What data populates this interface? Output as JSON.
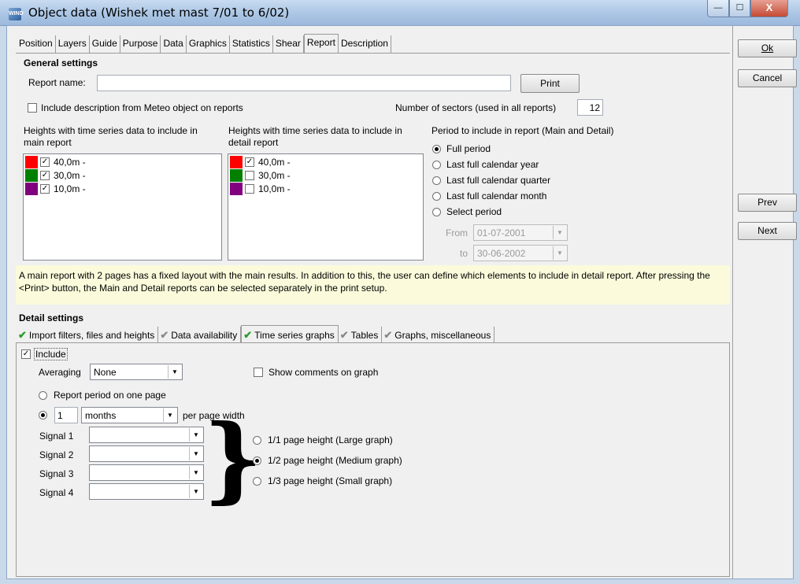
{
  "window": {
    "title": "Object data  (Wishek met mast 7/01 to 6/02)",
    "app_icon_text": "WIND",
    "min": "—",
    "max": "☐",
    "close": "X"
  },
  "side": {
    "ok": "Ok",
    "cancel": "Cancel",
    "prev": "Prev",
    "next": "Next"
  },
  "tabs": [
    "Position",
    "Layers",
    "Guide",
    "Purpose",
    "Data",
    "Graphics",
    "Statistics",
    "Shear",
    "Report",
    "Description"
  ],
  "active_tab": "Report",
  "general": {
    "heading": "General settings",
    "report_name_label": "Report name:",
    "report_name_value": "",
    "print_label": "Print",
    "include_desc_label": "Include description from Meteo object on reports",
    "include_desc_checked": false,
    "sectors_label": "Number of sectors (used in all reports)",
    "sectors_value": "12"
  },
  "main_heights": {
    "label": "Heights with time series data to include in main report",
    "items": [
      {
        "label": "40,0m -",
        "checked": true,
        "color": "#ff0000"
      },
      {
        "label": "30,0m -",
        "checked": true,
        "color": "#008000"
      },
      {
        "label": "10,0m -",
        "checked": true,
        "color": "#800080"
      }
    ]
  },
  "detail_heights": {
    "label": "Heights with time series data to include in detail report",
    "items": [
      {
        "label": "40,0m -",
        "checked": true,
        "color": "#ff0000"
      },
      {
        "label": "30,0m -",
        "checked": false,
        "color": "#008000"
      },
      {
        "label": "10,0m -",
        "checked": false,
        "color": "#800080"
      }
    ]
  },
  "period": {
    "label": "Period to include in report (Main and Detail)",
    "options": [
      "Full period",
      "Last full calendar year",
      "Last full calendar quarter",
      "Last full calendar month",
      "Select period"
    ],
    "selected": 0,
    "from_label": "From",
    "from_value": "01-07-2001",
    "to_label": "to",
    "to_value": "30-06-2002"
  },
  "info_text": "A main report with 2 pages has a fixed layout with the main results. In addition to this, the user can define which elements to include in detail report. After pressing the <Print> button, the Main and Detail reports can be selected separately in the print setup.",
  "detail": {
    "heading": "Detail settings",
    "tabs": [
      "Import filters, files and heights",
      "Data availability",
      "Time series graphs",
      "Tables",
      "Graphs, miscellaneous"
    ],
    "active_tab": "Time series graphs",
    "include_label": "Include",
    "include_checked": true,
    "averaging_label": "Averaging",
    "averaging_value": "None",
    "show_comments_label": "Show comments on graph",
    "report_period_label": "Report period on one page",
    "per_page_count": "1",
    "per_page_unit": "months",
    "per_page_label": "per page width",
    "signals": [
      {
        "label": "Signal 1",
        "value": ""
      },
      {
        "label": "Signal 2",
        "value": ""
      },
      {
        "label": "Signal 3",
        "value": ""
      },
      {
        "label": "Signal 4",
        "value": ""
      }
    ],
    "graph_sizes": [
      "1/1 page height (Large graph)",
      "1/2 page height (Medium graph)",
      "1/3 page height (Small graph)"
    ],
    "graph_size_selected": 1
  }
}
